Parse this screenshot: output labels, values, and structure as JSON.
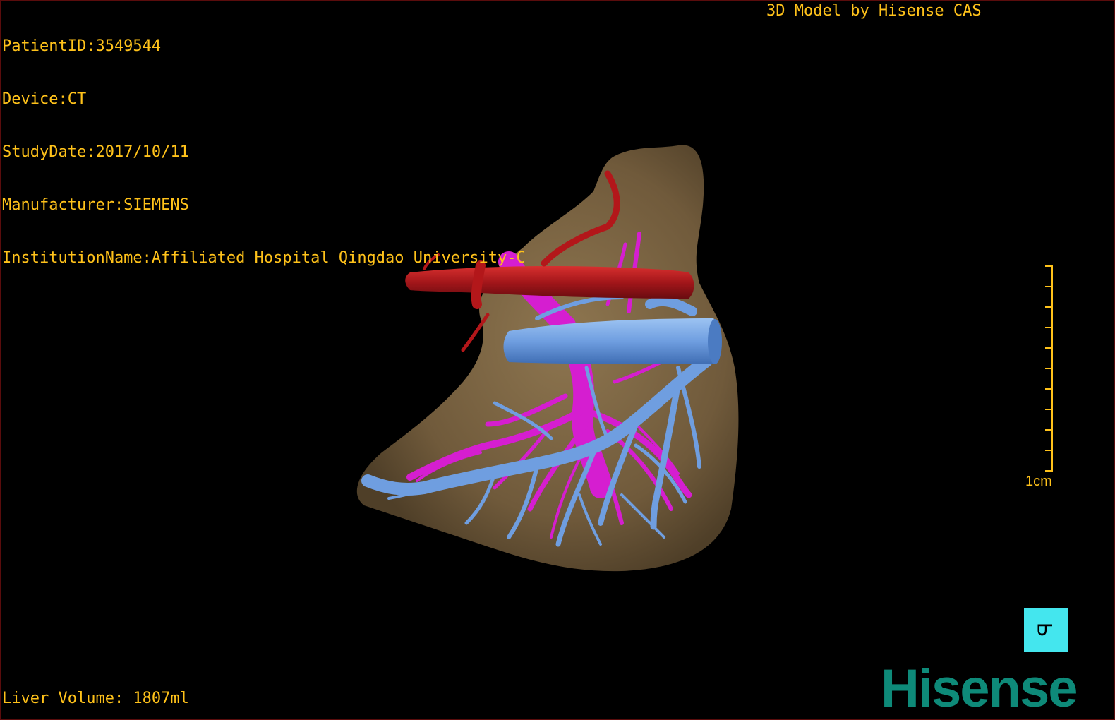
{
  "header": {
    "patient_id": "PatientID:3549544",
    "device": "Device:CT",
    "study_date": "StudyDate:2017/10/11",
    "manufacturer": "Manufacturer:SIEMENS",
    "institution": "InstitutionName:Affiliated Hospital Qingdao University-C"
  },
  "credit": "3D Model by Hisense CAS",
  "footer": {
    "liver_volume": "Liver Volume: 1807ml"
  },
  "scale": {
    "label": "1cm"
  },
  "orientation": {
    "label": "P"
  },
  "logo": {
    "text": "Hisense"
  },
  "colors": {
    "overlay_text": "#ffc21a",
    "liver": "#7a6443",
    "hepatic_artery": "#b3171a",
    "portal_vein": "#d51ed0",
    "hepatic_vein": "#6f9ee0",
    "orientation_cube": "#44e6ee",
    "logo": "#0e8a79"
  }
}
